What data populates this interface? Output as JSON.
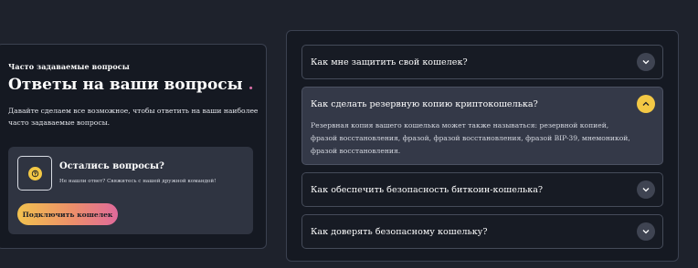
{
  "intro": {
    "eyebrow": "Часто задаваемые вопросы",
    "title": "Ответы на ваши вопросы",
    "title_dot": ".",
    "description": "Давайте сделаем все возможное, чтобы ответить на ваши наиболее часто задаваемые вопросы."
  },
  "help_card": {
    "icon": "question-icon",
    "title": "Остались вопросы?",
    "subtitle": "Не нашли ответ? Свяжитесь с нашей дружной командой!",
    "button_label": "Подключить кошелек"
  },
  "faq": {
    "items": [
      {
        "question": "Как мне защитить свой кошелек?",
        "expanded": false,
        "toggle_icon": "chevron-down-icon"
      },
      {
        "question": "Как сделать резервную копию криптокошелька?",
        "expanded": true,
        "toggle_icon": "chevron-up-icon",
        "answer": "Резервная копия вашего кошелька может также называться: резервной копией, фразой восстановления, фразой, фразой восстановления, фразой BIP-39, мнемоникой, фразой восстановления."
      },
      {
        "question": "Как обеспечить безопасность биткоин-кошелька?",
        "expanded": false,
        "toggle_icon": "chevron-down-icon"
      },
      {
        "question": "Как доверять безопасному кошельку?",
        "expanded": false,
        "toggle_icon": "chevron-down-icon"
      }
    ]
  },
  "colors": {
    "background": "#1e222c",
    "panel": "#151922",
    "accent_yellow": "#f3c845",
    "accent_pink": "#e06a9b"
  }
}
